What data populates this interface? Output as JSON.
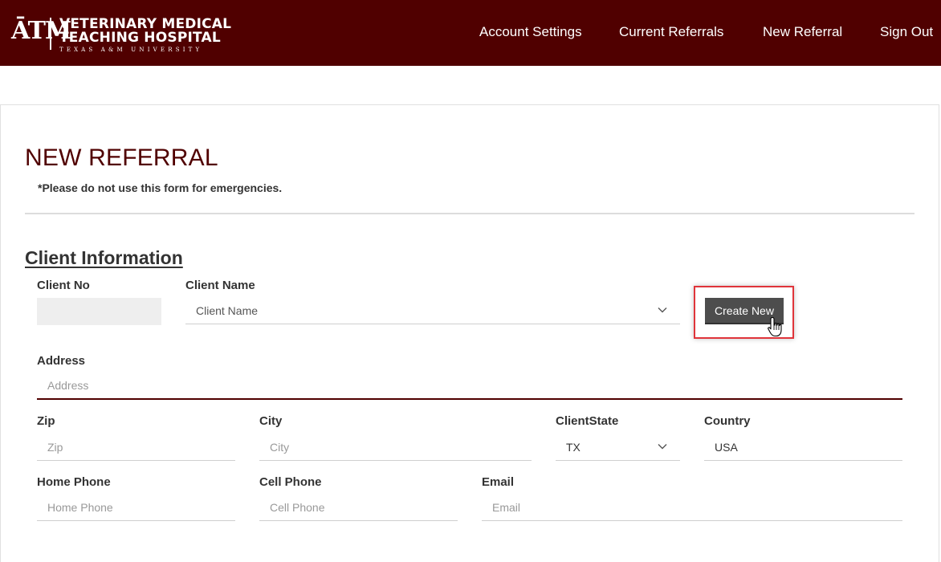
{
  "header": {
    "logo": {
      "mark": "ĀTM",
      "line1": "VETERINARY MEDICAL",
      "line2": "TEACHING HOSPITAL",
      "line3": "TEXAS A&M UNIVERSITY"
    },
    "nav": [
      "Account Settings",
      "Current Referrals",
      "New Referral",
      "Sign Out"
    ],
    "colors": {
      "brand": "#500000"
    }
  },
  "page": {
    "title": "NEW REFERRAL",
    "warning": "*Please do not use this form for emergencies."
  },
  "client": {
    "section_title": "Client Information",
    "client_no": {
      "label": "Client No",
      "value": ""
    },
    "client_name": {
      "label": "Client Name",
      "placeholder": "Client Name"
    },
    "create_button": "Create New",
    "address": {
      "label": "Address",
      "placeholder": "Address"
    },
    "zip": {
      "label": "Zip",
      "placeholder": "Zip"
    },
    "city": {
      "label": "City",
      "placeholder": "City"
    },
    "state": {
      "label": "ClientState",
      "value": "TX"
    },
    "country": {
      "label": "Country",
      "value": "USA"
    },
    "home_phone": {
      "label": "Home Phone",
      "placeholder": "Home Phone"
    },
    "cell_phone": {
      "label": "Cell Phone",
      "placeholder": "Cell Phone"
    },
    "email": {
      "label": "Email",
      "placeholder": "Email"
    }
  }
}
